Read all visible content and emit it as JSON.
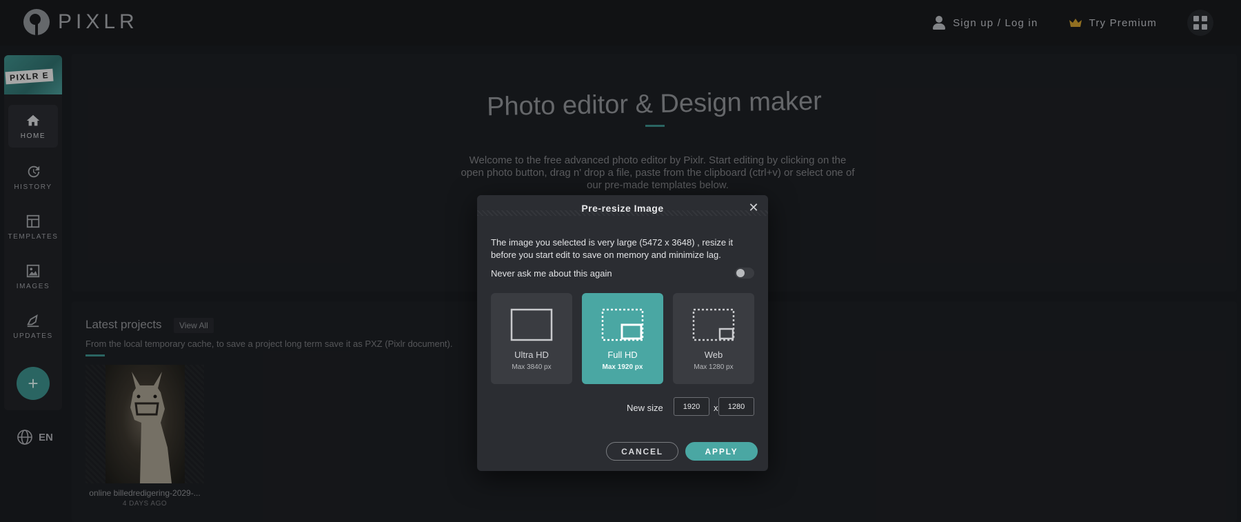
{
  "header": {
    "logo_text": "PIXLR",
    "signin_label": "Sign up / Log in",
    "premium_label": "Try Premium"
  },
  "sidebar": {
    "brand_tag": "PIXLR E",
    "items": [
      {
        "label": "HOME",
        "icon": "home-icon"
      },
      {
        "label": "HISTORY",
        "icon": "history-icon"
      },
      {
        "label": "TEMPLATES",
        "icon": "templates-icon"
      },
      {
        "label": "IMAGES",
        "icon": "images-icon"
      },
      {
        "label": "UPDATES",
        "icon": "updates-icon"
      }
    ],
    "add_label": "+",
    "language": "EN"
  },
  "hero": {
    "title": "Photo editor & Design maker",
    "description": "Welcome to the free advanced photo editor by Pixlr. Start editing by clicking on the open photo button, drag n' drop a file, paste from the clipboard (ctrl+v) or select one of our pre-made templates below."
  },
  "projects": {
    "title": "Latest projects",
    "view_all": "View All",
    "subtitle": "From the local temporary cache, to save a project long term save it as PXZ (Pixlr document).",
    "items": [
      {
        "caption": "online billedredigering-2029-...",
        "date": "4 DAYS AGO"
      }
    ]
  },
  "modal": {
    "title": "Pre-resize Image",
    "close": "✕",
    "message": "The image you selected is very large (5472 x 3648) , resize it before you start edit to save on memory and minimize lag.",
    "never_ask": "Never ask me about this again",
    "never_ask_enabled": false,
    "options": [
      {
        "name": "Ultra HD",
        "max": "Max 3840 px",
        "selected": false
      },
      {
        "name": "Full HD",
        "max": "Max 1920 px",
        "selected": true
      },
      {
        "name": "Web",
        "max": "Max 1280 px",
        "selected": false
      }
    ],
    "new_size_label": "New size",
    "width_value": "1920",
    "height_value": "1280",
    "size_separator": "x",
    "cancel_label": "CANCEL",
    "apply_label": "APPLY"
  },
  "colors": {
    "accent": "#4aa7a3",
    "background": "#1a1c20",
    "modal_bg": "#2b2d32",
    "premium_crown": "#c99a2e"
  }
}
